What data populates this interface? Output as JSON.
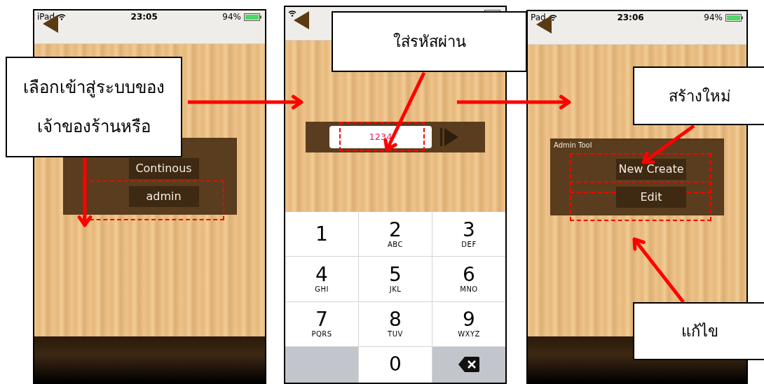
{
  "screens": [
    {
      "kind": "menu",
      "carrier": "iPad",
      "time": "23:05",
      "battery": "94%",
      "buttons": [
        {
          "label": "Continous",
          "highlighted": false
        },
        {
          "label": "admin",
          "highlighted": true
        }
      ]
    },
    {
      "kind": "passcode",
      "passcode": {
        "value": "1234",
        "highlighted": true
      },
      "keys": [
        {
          "digit": "1"
        },
        {
          "digit": "2",
          "letters": "ABC"
        },
        {
          "digit": "3",
          "letters": "DEF"
        },
        {
          "digit": "4",
          "letters": "GHI"
        },
        {
          "digit": "5",
          "letters": "JKL"
        },
        {
          "digit": "6",
          "letters": "MNO"
        },
        {
          "digit": "7",
          "letters": "PQRS"
        },
        {
          "digit": "8",
          "letters": "TUV"
        },
        {
          "digit": "9",
          "letters": "WXYZ"
        },
        {
          "kind": "blank"
        },
        {
          "digit": "0"
        },
        {
          "kind": "delete"
        }
      ]
    },
    {
      "kind": "menu",
      "carrier": "Pad",
      "time": "23:06",
      "battery": "94%",
      "panel_title": "Admin Tool",
      "buttons": [
        {
          "label": "New Create",
          "highlighted": true
        },
        {
          "label": "Edit",
          "highlighted": true
        }
      ]
    }
  ],
  "callouts": [
    {
      "lines": [
        "เลือกเข้าสู่ระบบของ",
        "เจ้าของร้านหรือ"
      ]
    },
    {
      "lines": [
        "ใส่รหัสผ่าน"
      ]
    },
    {
      "lines": [
        "สร้างใหม่"
      ]
    },
    {
      "lines": [
        "แก้ไข"
      ]
    }
  ]
}
